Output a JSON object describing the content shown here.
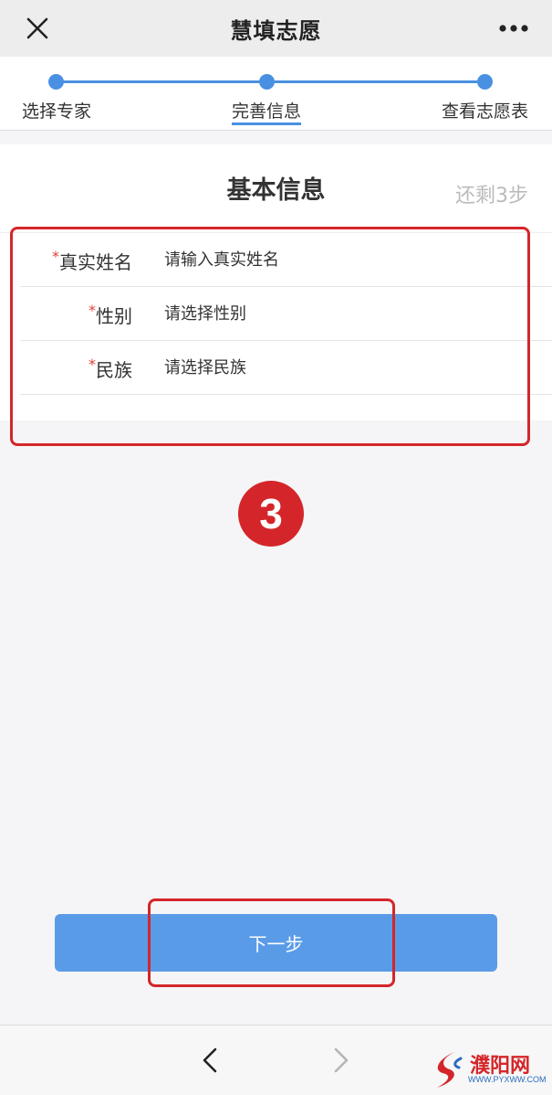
{
  "nav": {
    "title": "慧填志愿",
    "close_icon": "close-icon",
    "more_icon": "more-icon"
  },
  "stepper": {
    "steps": [
      {
        "label": "选择专家"
      },
      {
        "label": "完善信息",
        "active": true
      },
      {
        "label": "查看志愿表"
      }
    ],
    "color": "#4a90e2"
  },
  "section": {
    "title": "基本信息",
    "steps_left": "还剩3步"
  },
  "form": {
    "fields": [
      {
        "label": "真实姓名",
        "required_mark": "*",
        "placeholder": "请输入真实姓名"
      },
      {
        "label": "性别",
        "required_mark": "*",
        "placeholder": "请选择性别"
      },
      {
        "label": "民族",
        "required_mark": "*",
        "placeholder": "请选择民族"
      }
    ]
  },
  "annotation": {
    "marker": "3",
    "color": "#d4262a"
  },
  "footer": {
    "next_label": "下一步",
    "button_color": "#5a9be8"
  },
  "toolbar": {
    "back_icon": "chevron-left-icon",
    "forward_icon": "chevron-right-icon"
  },
  "watermark": {
    "name": "濮阳网",
    "url": "WWW.PYXWW.COM"
  }
}
